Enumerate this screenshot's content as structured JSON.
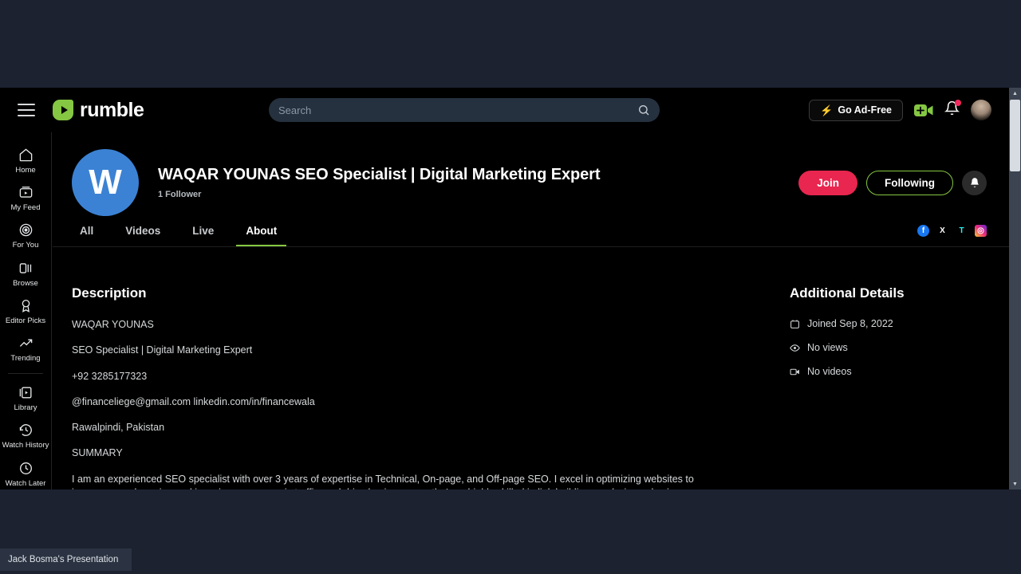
{
  "browser": {
    "topbar": {
      "menu_icon": "hamburger-icon",
      "brand": "rumble",
      "search": {
        "value": "",
        "placeholder": "Search",
        "icon": "search-icon"
      },
      "ad_free_label": "Go Ad-Free",
      "bolt_icon": "bolt-icon",
      "upload_icon": "video-upload-icon",
      "bell_icon": "bell-icon",
      "avatar": "user-avatar"
    },
    "sidebar": {
      "items": [
        {
          "label": "Home",
          "icon": "home-icon"
        },
        {
          "label": "My Feed",
          "icon": "my-feed-icon"
        },
        {
          "label": "For You",
          "icon": "for-you-icon"
        },
        {
          "label": "Browse",
          "icon": "browse-icon"
        },
        {
          "label": "Editor Picks",
          "icon": "editor-picks-icon"
        },
        {
          "label": "Trending",
          "icon": "trending-icon"
        }
      ],
      "items2": [
        {
          "label": "Library",
          "icon": "library-icon"
        },
        {
          "label": "Watch History",
          "icon": "watch-history-icon"
        },
        {
          "label": "Watch Later",
          "icon": "watch-later-icon"
        }
      ]
    },
    "profile": {
      "avatar_letter": "W",
      "avatar_color": "#3b82d4",
      "title": "WAQAR YOUNAS SEO Specialist | Digital Marketing Expert",
      "followers": "1 Follower",
      "join_label": "Join",
      "following_label": "Following",
      "join_color": "#e8264f",
      "following_border_color": "#85c742",
      "bell_icon": "notification-bell-icon"
    },
    "tabs": [
      {
        "label": "All",
        "active": false
      },
      {
        "label": "Videos",
        "active": false
      },
      {
        "label": "Live",
        "active": false
      },
      {
        "label": "About",
        "active": true
      }
    ],
    "socials": [
      {
        "name": "facebook-icon",
        "glyph": "f"
      },
      {
        "name": "x-twitter-icon",
        "glyph": "X"
      },
      {
        "name": "tiktok-icon",
        "glyph": "T"
      },
      {
        "name": "instagram-icon",
        "glyph": "◎"
      }
    ],
    "description": {
      "heading": "Description",
      "lines": [
        "WAQAR YOUNAS",
        "SEO Specialist | Digital Marketing Expert",
        "+92 3285177323",
        "@financeliege@gmail.com linkedin.com/in/financewala",
        "Rawalpindi, Pakistan",
        "SUMMARY"
      ],
      "summary": "I am an experienced SEO specialist with over 3 years of expertise in Technical, On-page, and Off-page SEO. I excel in optimizing websites to improve search engine rankings, increase organic traffic, and drive business growth. I am highly skilled in link building, analysis, and using Google Search"
    },
    "additional_details": {
      "heading": "Additional Details",
      "rows": [
        {
          "icon": "calendar-icon",
          "text": "Joined Sep 8, 2022"
        },
        {
          "icon": "eye-icon",
          "text": "No views"
        },
        {
          "icon": "video-icon",
          "text": "No videos"
        }
      ]
    }
  },
  "taskbar": {
    "item_label": "Jack Bosma's Presentation"
  }
}
